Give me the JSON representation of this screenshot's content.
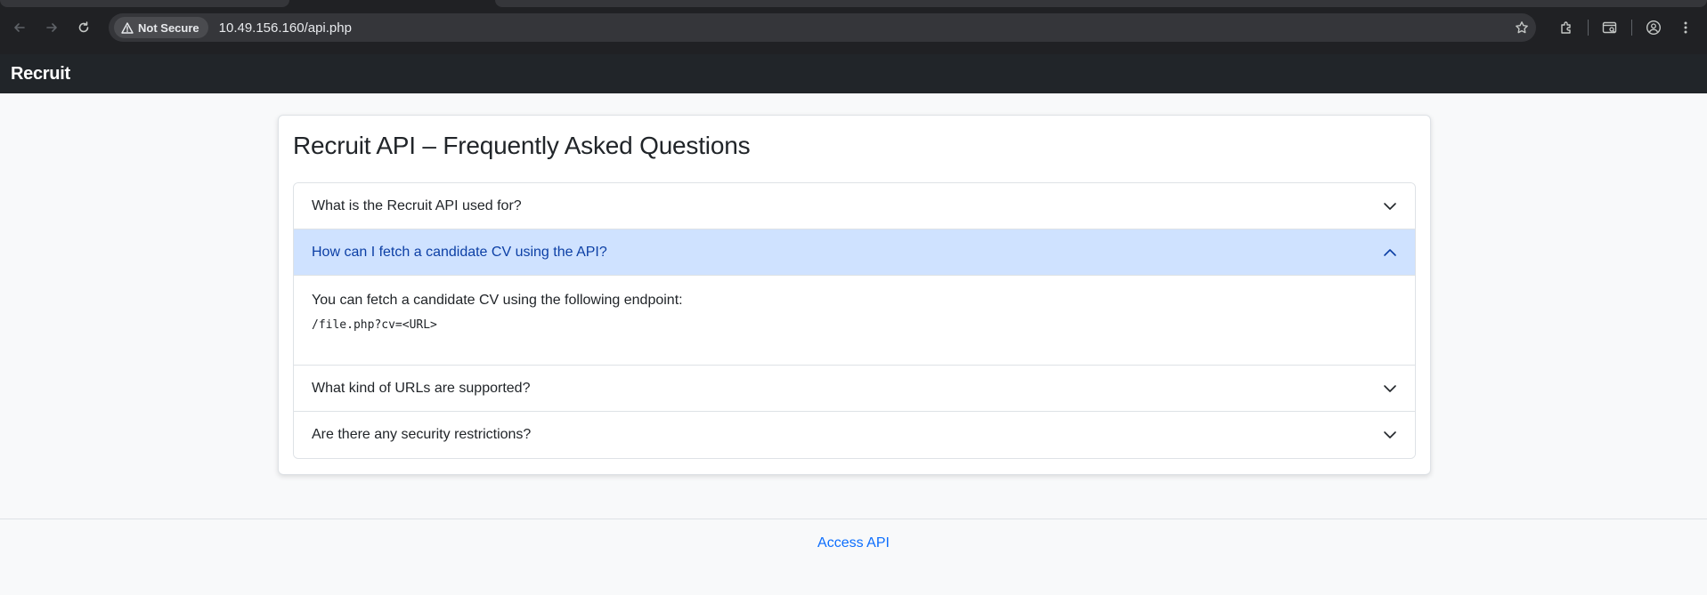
{
  "browser": {
    "security_label": "Not Secure",
    "url": "10.49.156.160/api.php"
  },
  "navbar": {
    "brand": "Recruit"
  },
  "faq": {
    "title": "Recruit API – Frequently Asked Questions",
    "items": [
      {
        "question": "What is the Recruit API used for?",
        "expanded": false
      },
      {
        "question": "How can I fetch a candidate CV using the API?",
        "expanded": true,
        "answer_text": "You can fetch a candidate CV using the following endpoint:",
        "answer_code": "/file.php?cv=<URL>"
      },
      {
        "question": "What kind of URLs are supported?",
        "expanded": false
      },
      {
        "question": "Are there any security restrictions?",
        "expanded": false
      }
    ]
  },
  "footer": {
    "link": "Access API"
  },
  "colors": {
    "navbar_bg": "#212529",
    "accordion_open_bg": "#cfe2ff",
    "accordion_open_text": "#0c3fa5",
    "link": "#0d6efd"
  }
}
